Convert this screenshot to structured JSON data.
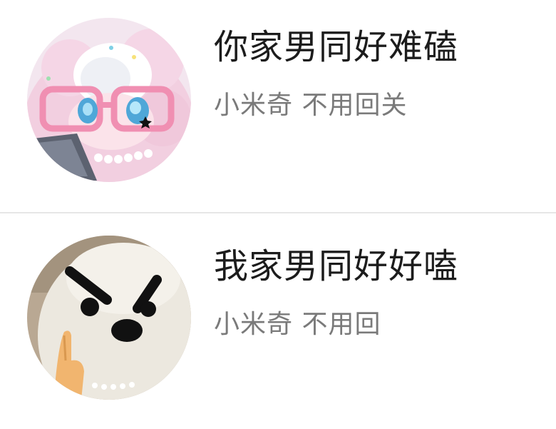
{
  "conversations": [
    {
      "title": "你家男同好难磕",
      "preview": "小米奇 不用回关",
      "avatar_icon": "pink-plush-doll-with-glasses-avatar"
    },
    {
      "title": "我家男同好好嗑",
      "preview": "小米奇 不用回",
      "avatar_icon": "angry-white-plush-avatar"
    }
  ],
  "colors": {
    "background": "#ffffff",
    "title_text": "#1c1c1c",
    "preview_text": "#7a7a7a",
    "divider": "#e6e6e6"
  }
}
